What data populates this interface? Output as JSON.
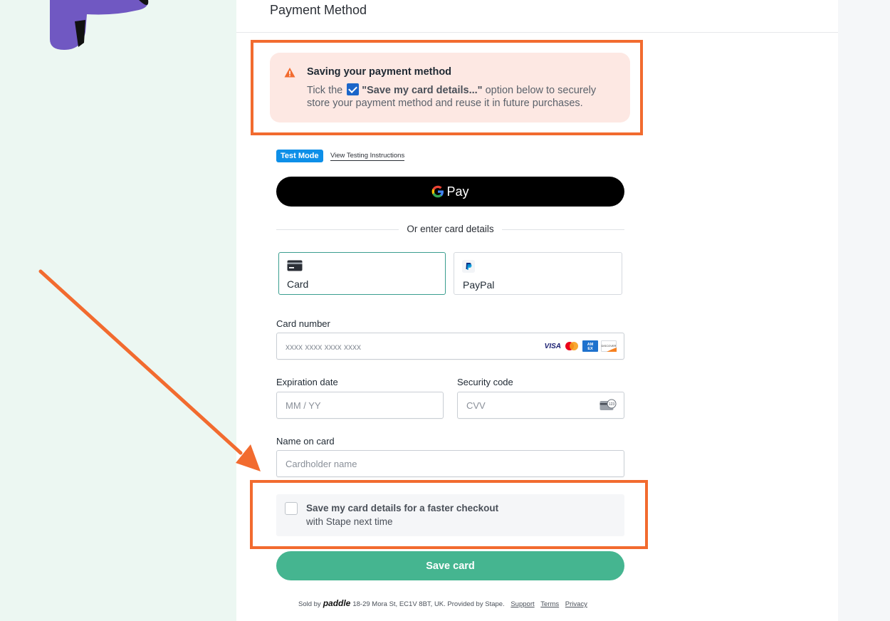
{
  "header": {
    "title": "Payment Method"
  },
  "alert": {
    "title": "Saving your payment method",
    "body_prefix": "Tick the",
    "body_bold": "\"Save my card details...\"",
    "body_suffix": "option below to securely store your payment method and reuse it in future purchases."
  },
  "testing": {
    "badge": "Test Mode",
    "link": "View Testing Instructions"
  },
  "gpay": {
    "label": "Pay"
  },
  "divider": {
    "text": "Or enter card details"
  },
  "methods": [
    {
      "label": "Card",
      "selected": true,
      "icon": "credit-card-icon"
    },
    {
      "label": "PayPal",
      "selected": false,
      "icon": "paypal-icon"
    }
  ],
  "form": {
    "card_number": {
      "label": "Card number",
      "placeholder": "xxxx xxxx xxxx xxxx",
      "brands": [
        "VISA",
        "Mastercard",
        "AMEX",
        "DISCOVER"
      ]
    },
    "expiration": {
      "label": "Expiration date",
      "placeholder": "MM / YY"
    },
    "security": {
      "label": "Security code",
      "placeholder": "CVV",
      "icon_text": "123"
    },
    "name": {
      "label": "Name on card",
      "placeholder": "Cardholder name"
    }
  },
  "save_option": {
    "line1": "Save my card details for a faster checkout",
    "line2": "with Stape next time",
    "checked": false
  },
  "save_button": {
    "label": "Save card"
  },
  "footer": {
    "sold_by": "Sold by",
    "brand": "paddle",
    "address": "18-29 Mora St, EC1V 8BT, UK.",
    "provided_by": "Provided by",
    "provider": "Stape.",
    "links": [
      "Support",
      "Terms",
      "Privacy"
    ]
  },
  "colors": {
    "accent_orange": "#f26b2f",
    "alert_bg": "#fde8e3",
    "save_button_bg": "#45b590",
    "test_badge_bg": "#0d8fe8",
    "selected_border": "#3a9e8f"
  }
}
